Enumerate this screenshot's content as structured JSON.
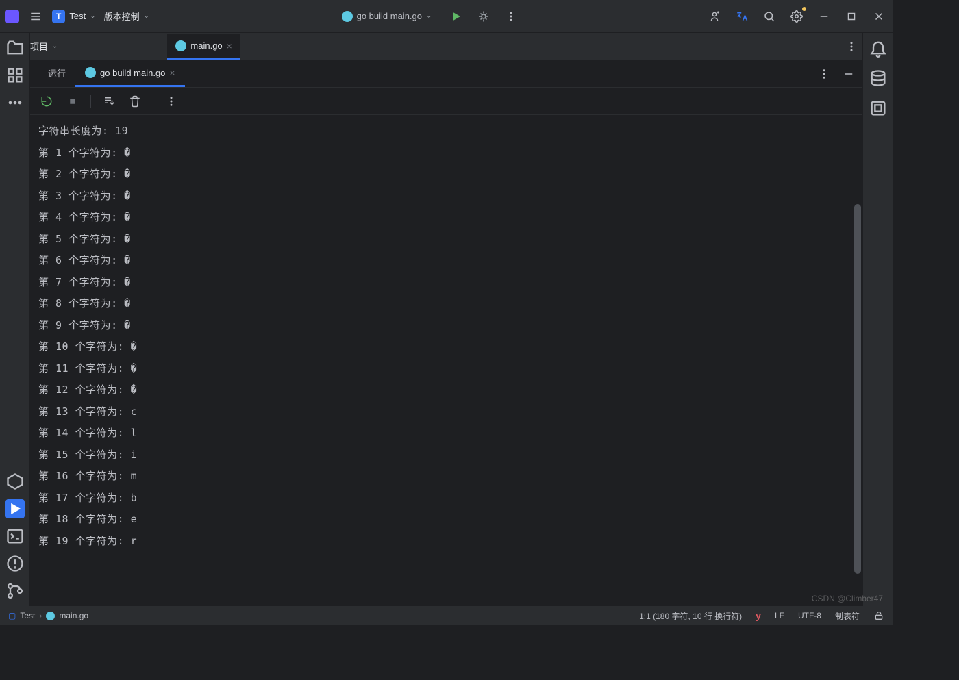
{
  "topbar": {
    "project_badge": "T",
    "project_name": "Test",
    "vcs_label": "版本控制",
    "run_config": "go build main.go"
  },
  "sub_header": {
    "project_dropdown": "项目"
  },
  "file_tab": {
    "name": "main.go"
  },
  "run_tabs": {
    "run_label": "运行",
    "config_label": "go build main.go"
  },
  "console": {
    "length_line": "字符串长度为: 19",
    "lines": [
      "第 1 个字符为: �",
      "第 2 个字符为: �",
      "第 3 个字符为: �",
      "第 4 个字符为: �",
      "第 5 个字符为: �",
      "第 6 个字符为: �",
      "第 7 个字符为: �",
      "第 8 个字符为: �",
      "第 9 个字符为: �",
      "第 10 个字符为: �",
      "第 11 个字符为: �",
      "第 12 个字符为: �",
      "第 13 个字符为: c",
      "第 14 个字符为: l",
      "第 15 个字符为: i",
      "第 16 个字符为: m",
      "第 17 个字符为: b",
      "第 18 个字符为: e",
      "第 19 个字符为: r"
    ]
  },
  "statusbar": {
    "project": "Test",
    "file": "main.go",
    "position": "1:1 (180 字符, 10 行 换行符)",
    "line_sep": "LF",
    "encoding": "UTF-8",
    "indent": "制表符"
  },
  "watermark": "CSDN @Climber47"
}
